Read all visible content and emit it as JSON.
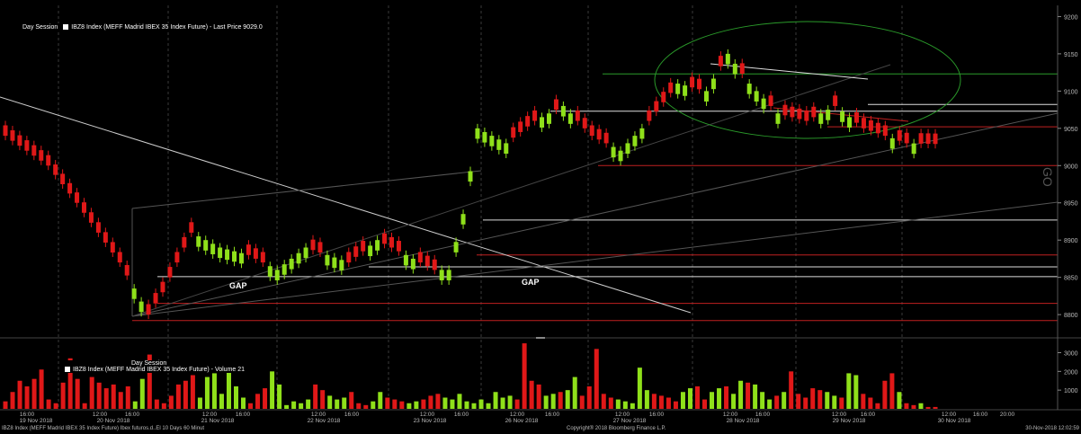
{
  "price_panel": {
    "session_label": "Day Session",
    "series_label": "IBZ8 Index (MEFF Madrid IBEX 35 Index Future) - Last Price 9029.0"
  },
  "volume_panel": {
    "session_label": "Day Session",
    "series_label": "IBZ8 Index (MEFF Madrid IBEX 35 Index Future) - Volume 21"
  },
  "annotations": {
    "gap1": "GAP",
    "gap2": "GAP",
    "watermark": "GO"
  },
  "footer": {
    "left": "IBZ8 Index (MEFF Madrid IBEX 35 Index Future) Ibex futuros.d..El 10 Days 60 Minut",
    "center": "Copyright® 2018 Bloomberg Finance L.P.",
    "right": "30-Nov-2018 12:02:59"
  },
  "colors": {
    "up": "#8fe01a",
    "down": "#e01818",
    "background": "#000000",
    "axis_text": "#bbbbbb",
    "ellipse": "#2a9a2a"
  },
  "chart_data": [
    {
      "type": "candlestick",
      "title": "",
      "ylim": [
        8770,
        9215
      ],
      "yticks": [
        8800,
        8850,
        8900,
        8950,
        9000,
        9050,
        9100,
        9150,
        9200
      ],
      "up_flags": [
        0,
        0,
        0,
        0,
        0,
        0,
        0,
        0,
        0,
        0,
        0,
        0,
        0,
        0,
        0,
        0,
        0,
        0,
        1,
        1,
        0,
        0,
        0,
        0,
        0,
        0,
        0,
        1,
        1,
        1,
        1,
        1,
        1,
        1,
        0,
        0,
        0,
        1,
        1,
        1,
        1,
        1,
        1,
        0,
        0,
        1,
        1,
        1,
        0,
        0,
        0,
        1,
        1,
        0,
        0,
        0,
        1,
        1,
        0,
        0,
        0,
        1,
        1,
        1,
        1,
        1,
        1,
        1,
        1,
        1,
        1,
        0,
        0,
        0,
        0,
        1,
        1,
        0,
        1,
        1,
        0,
        0,
        0,
        0,
        0,
        1,
        1,
        1,
        1,
        1,
        0,
        0,
        0,
        0,
        1,
        1,
        0,
        0,
        1,
        1,
        0,
        1,
        1,
        0,
        1,
        1,
        1,
        0,
        1,
        0,
        0,
        0,
        0,
        0,
        1,
        1,
        0,
        1,
        1,
        0,
        0,
        0,
        0,
        0,
        1,
        0,
        0,
        1,
        0,
        0,
        0
      ]
    },
    {
      "type": "bar",
      "title": "",
      "ylim": [
        0,
        3600
      ],
      "yticks": [
        1000,
        2000,
        3000
      ],
      "values": [
        400,
        900,
        1500,
        1200,
        1600,
        2100,
        500,
        300,
        1400,
        2700,
        1600,
        300,
        1700,
        1400,
        1100,
        1300,
        900,
        1200,
        400,
        1600,
        2900,
        500,
        300,
        700,
        1300,
        1500,
        1800,
        600,
        1700,
        1900,
        800,
        2100,
        1200,
        600,
        300,
        800,
        1100,
        2000,
        1300,
        200,
        400,
        300,
        500,
        1300,
        1000,
        700,
        500,
        600,
        900,
        300,
        200,
        400,
        900,
        600,
        500,
        400,
        300,
        400,
        500,
        700,
        800,
        600,
        500,
        800,
        400,
        300,
        500,
        300,
        900,
        600,
        700,
        500,
        3500,
        1500,
        1300,
        700,
        800,
        900,
        1000,
        1700,
        700,
        1200,
        3200,
        800,
        600,
        500,
        400,
        300,
        2200,
        1000,
        800,
        700,
        600,
        400,
        900,
        1100,
        1200,
        500,
        900,
        1100,
        1200,
        800,
        1500,
        1400,
        1300,
        900,
        500,
        700,
        900,
        2000,
        800,
        600,
        1100,
        1000,
        900,
        700,
        600,
        1900,
        1800,
        800,
        600,
        300,
        1500,
        1900,
        900,
        300,
        200,
        300,
        100,
        100
      ]
    }
  ],
  "x_axis": {
    "tick_labels": [
      {
        "row": 1,
        "text": "16:00"
      },
      {
        "row": 2,
        "text": "19 Nov 2018"
      },
      {
        "row": 1,
        "text": "12:00"
      },
      {
        "row": 1,
        "text": "16:00"
      },
      {
        "row": 2,
        "text": "20 Nov 2018"
      },
      {
        "row": 1,
        "text": "12:00"
      },
      {
        "row": 1,
        "text": "16:00"
      },
      {
        "row": 2,
        "text": "21 Nov 2018"
      },
      {
        "row": 1,
        "text": "12:00"
      },
      {
        "row": 1,
        "text": "16:00"
      },
      {
        "row": 2,
        "text": "22 Nov 2018"
      },
      {
        "row": 1,
        "text": "12:00"
      },
      {
        "row": 1,
        "text": "16:00"
      },
      {
        "row": 2,
        "text": "23 Nov 2018"
      },
      {
        "row": 1,
        "text": "12:00"
      },
      {
        "row": 1,
        "text": "16:00"
      },
      {
        "row": 2,
        "text": "26 Nov 2018"
      },
      {
        "row": 1,
        "text": "12:00"
      },
      {
        "row": 1,
        "text": "16:00"
      },
      {
        "row": 2,
        "text": "27 Nov 2018"
      },
      {
        "row": 1,
        "text": "12:00"
      },
      {
        "row": 1,
        "text": "16:00"
      },
      {
        "row": 2,
        "text": "28 Nov 2018"
      },
      {
        "row": 1,
        "text": "12:00"
      },
      {
        "row": 1,
        "text": "16:00"
      },
      {
        "row": 2,
        "text": "29 Nov 2018"
      },
      {
        "row": 1,
        "text": "12:00"
      },
      {
        "row": 1,
        "text": "16:00"
      },
      {
        "row": 1,
        "text": "20:00"
      },
      {
        "row": 2,
        "text": "30 Nov 2018"
      }
    ]
  }
}
